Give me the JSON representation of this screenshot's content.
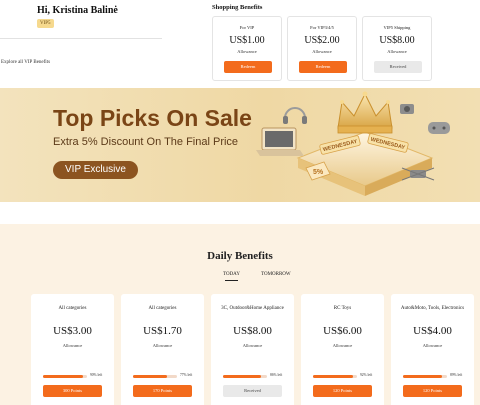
{
  "header": {
    "greeting": "Hi, Kristina Balinė",
    "vip_badge": "VIP5",
    "explore_link": "Explore all VIP Benefits"
  },
  "shopping_benefits": {
    "title": "Shopping Benefits",
    "cards": [
      {
        "label": "For VIP",
        "amount": "US$1.00",
        "sub": "Allowance",
        "button": "Redeem",
        "state": "redeem"
      },
      {
        "label": "For VIP3/4/5",
        "amount": "US$2.00",
        "sub": "Allowance",
        "button": "Redeem",
        "state": "redeem"
      },
      {
        "label": "VIP5 Shipping",
        "amount": "US$8.00",
        "sub": "Allowance",
        "button": "Received",
        "state": "received"
      }
    ]
  },
  "banner": {
    "title": "Top Picks On Sale",
    "subtitle": "Extra 5% Discount On The Final Price",
    "pill": "VIP Exclusive",
    "art_words": [
      "WEDNESDAY",
      "WEDNESDAY"
    ],
    "discount_tag": "5%"
  },
  "daily_benefits": {
    "title": "Daily Benefits",
    "tabs": [
      {
        "label": "TODAY",
        "active": true
      },
      {
        "label": "TOMORROW",
        "active": false
      }
    ],
    "cards": [
      {
        "category": "All categories",
        "amount": "US$3.00",
        "sub": "Allowance",
        "progress": 0.9,
        "left_text": "90% left",
        "button": "300 Points",
        "state": "points"
      },
      {
        "category": "All categories",
        "amount": "US$1.70",
        "sub": "Allowance",
        "progress": 0.77,
        "left_text": "77% left",
        "button": "170 Points",
        "state": "points"
      },
      {
        "category": "3C, Outdoor&Home Appliance",
        "amount": "US$8.00",
        "sub": "Allowance",
        "progress": 0.86,
        "left_text": "86% left",
        "button": "Received",
        "state": "received"
      },
      {
        "category": "RC Toys",
        "amount": "US$6.00",
        "sub": "Allowance",
        "progress": 0.92,
        "left_text": "92% left",
        "button": "120 Points",
        "state": "points"
      },
      {
        "category": "Auto&Moto, Tools, Electronics",
        "amount": "US$4.00",
        "sub": "Allowance",
        "progress": 0.89,
        "left_text": "89% left",
        "button": "120 Points",
        "state": "points"
      }
    ]
  },
  "colors": {
    "accent": "#f36b1c",
    "banner_title": "#7a4516",
    "pill": "#8c5420",
    "vip_badge": "#f6d98e",
    "daily_bg": "#fcf2e3"
  }
}
